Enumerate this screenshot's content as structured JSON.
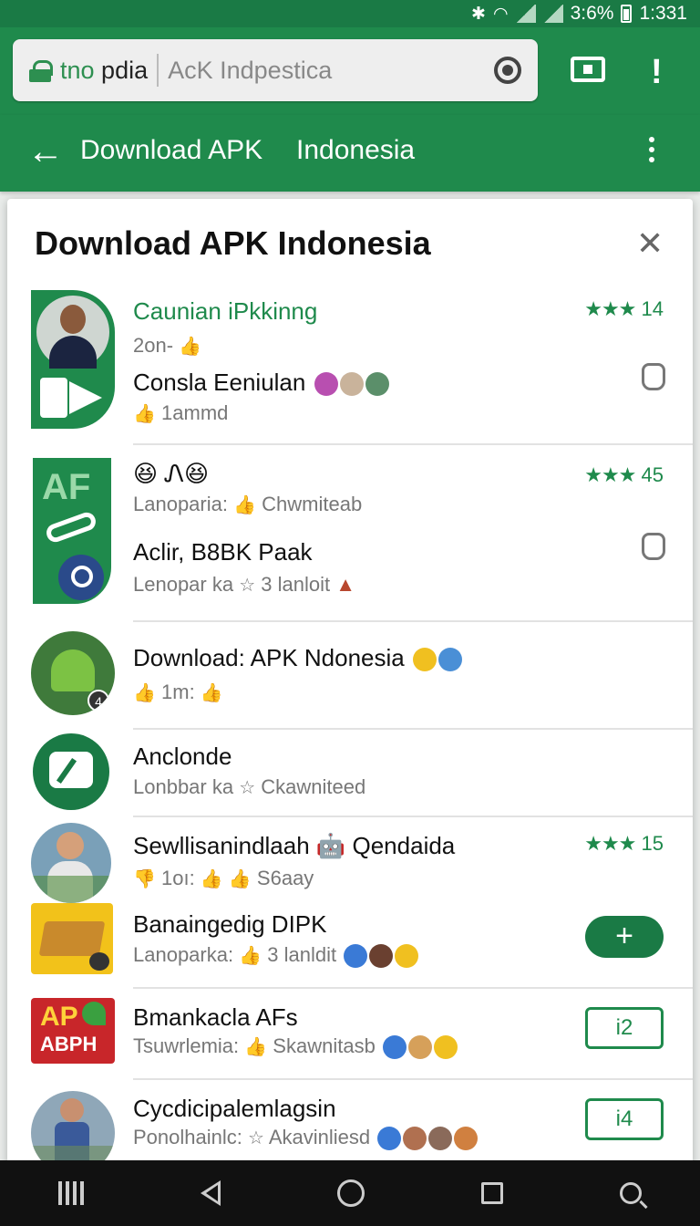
{
  "status_bar": {
    "battery": "3:6%",
    "time": "1:331",
    "bt": "✱",
    "wifi": "◠"
  },
  "browser": {
    "host_green": "tno",
    "host_rest": " pdia",
    "path": "AcK Indpestica",
    "camera_icon": "camera-icon",
    "tabs_icon": "tabs-icon",
    "alert_icon": "!"
  },
  "app_bar": {
    "back": "←",
    "title": "Download APK",
    "title2": "Indonesia"
  },
  "dialog": {
    "title": "Download APK Indonesia",
    "close": "✕",
    "items": [
      {
        "title": "Caunian iPkkinng",
        "sub1": "2on-",
        "sub1_like": "👍",
        "title2": "Consla Eeniulan",
        "sub2": "1ammd",
        "rating_stars": "★★★",
        "rating": "14"
      },
      {
        "title": "😆 Ꮑ😆",
        "sub1": "Lanoparia:",
        "sub1b": "Chwmiteab",
        "title2": "Aclir, B8BK Paak",
        "sub2": "Lenopar ka",
        "sub2b": "3 lanloit",
        "rating_stars": "★★★",
        "rating": "45"
      },
      {
        "title": "Download: APK Ndonesia",
        "sub1": "1m:",
        "badge": "4"
      },
      {
        "title": "Anclonde",
        "sub1": "Lonbbar ka",
        "sub1b": "Ckawniteed"
      },
      {
        "title": "Sewllisanindlaah 🤖 Qendaida",
        "sub1": "1oı:",
        "sub1b": "S6aay",
        "rating_stars": "★★★",
        "rating": "15"
      },
      {
        "title": "Banaingedig DIPK",
        "sub1": "Lanoparka:",
        "sub1b": "3 lanldit",
        "button": "+"
      },
      {
        "title": "Bmankacla AFs",
        "sub1": "Tsuwrlemia:",
        "sub1b": "Skawnitasb",
        "button": "i2",
        "logo": "AP",
        "logo2": "ABPH"
      },
      {
        "title": "Cycdicipalemlagsin",
        "sub1": "Ponolhainlc:",
        "sub1b": "Akavinliesd",
        "button": "i4"
      }
    ],
    "af_logo": "AF"
  },
  "colors": {
    "primary": "#1f8a4c",
    "dark": "#1a7a45"
  }
}
